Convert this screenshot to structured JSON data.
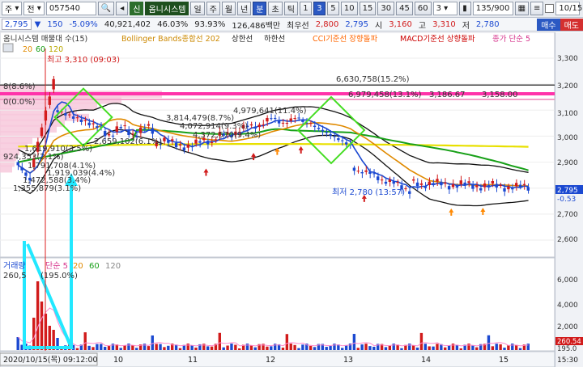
{
  "toolbar": {
    "mode": "주",
    "period_type": "전",
    "stock_code": "057540",
    "badge": "신",
    "stock_name": "옴니시스템",
    "intervals": [
      "일",
      "주",
      "월",
      "년",
      "분",
      "초",
      "틱"
    ],
    "active_interval": "분",
    "numbers": [
      "1",
      "3",
      "5",
      "10",
      "15",
      "30",
      "45",
      "60"
    ],
    "active_number": "3",
    "select_value": "3",
    "count": "135/900",
    "date_value": "10/15"
  },
  "quote": {
    "price": "2,795",
    "change": "150",
    "change_pct": "-5.09%",
    "volume": "40,921,402",
    "volume_ratio": "46.03%",
    "strength": "93.93%",
    "amount": "126,486백만",
    "priority_label": "최우선",
    "bid": "2,800",
    "ask": "2,795",
    "open_label": "시",
    "open": "3,160",
    "high_label": "고",
    "high": "3,310",
    "low_label": "저",
    "low": "2,780",
    "sell_label": "매수",
    "buy_label": "매도"
  },
  "legend": {
    "items": [
      {
        "label": "옴니시스템 매물대 수(15)",
        "color": "#333333"
      },
      {
        "label": "Bollinger Bands종합선 202",
        "color": "#cc8800"
      },
      {
        "label": "상한선",
        "color": "#222222"
      },
      {
        "label": "하한선",
        "color": "#222222"
      },
      {
        "label": "CCI기준선 장향돌파",
        "color": "#ff6600"
      },
      {
        "label": "MACD기준선 상향돌파",
        "color": "#cc0000"
      },
      {
        "label": "종가 단순 5",
        "color": "#d6338c"
      }
    ],
    "ma_labels": [
      {
        "label": "20",
        "color": "#e08a00"
      },
      {
        "label": "60",
        "color": "#18a018"
      },
      {
        "label": "120",
        "color": "#d8c800"
      }
    ]
  },
  "annotations": {
    "high": "최고 3,310 (09:03)",
    "low": "최저 2,780 (13:57)",
    "top_left_a": "8(8.6%)",
    "top_left_b": "0(0.0%)",
    "vp1": "6,630,758(15.2%)",
    "vp2": "6,979,458(13.1%)",
    "vp2_b": "3,186.67",
    "vp2_c": "3,158.00",
    "vp3": "4,979,641(11.4%)",
    "vp4": "3,814,479(8.7%)",
    "vp5": "4,072,914(9.3%)",
    "vp6": "4,372,570(9.4%)",
    "vp7": "2,659,102(6.1%)",
    "vp8": "1,619,910(3.5%)",
    "vp9": "924,353(2.1%)",
    "vp10": "1,791,708(4.1%)",
    "vp11": "1,919,039(4.4%)",
    "vp12": "1,472,588(3.4%)",
    "vp13": "1,355,879(3.1%)"
  },
  "volume_panel": {
    "title": "거래량",
    "ma_label": "단순 5",
    "ma_values": [
      "20",
      "60",
      "120"
    ],
    "value_text": "260,5",
    "pct_text": "(195.0%)"
  },
  "axis": {
    "y_ticks": [
      "3,300",
      "3,200",
      "3,100",
      "3,000",
      "2,900",
      "2,800",
      "2,700",
      "2,600"
    ],
    "current_price": "2,795",
    "current_pct": "-0.53",
    "vol_ticks": [
      "6,000",
      "4,000",
      "2,000"
    ],
    "vol_current": "260.54",
    "vol_base": "195.0",
    "x_labels": [
      "2020/10/15(목) 09:12:00",
      "10",
      "11",
      "12",
      "13",
      "14",
      "15"
    ],
    "time_right": "15:30"
  },
  "colors": {
    "up": "#d11b1b",
    "down": "#1b49d1",
    "ma5": "#d6338c",
    "ma20": "#e08a00",
    "ma60": "#18a018",
    "ma120": "#e8e000",
    "bb": "#111111",
    "highlight_green": "#44dd22",
    "highlight_cyan": "#22e8ff"
  }
}
